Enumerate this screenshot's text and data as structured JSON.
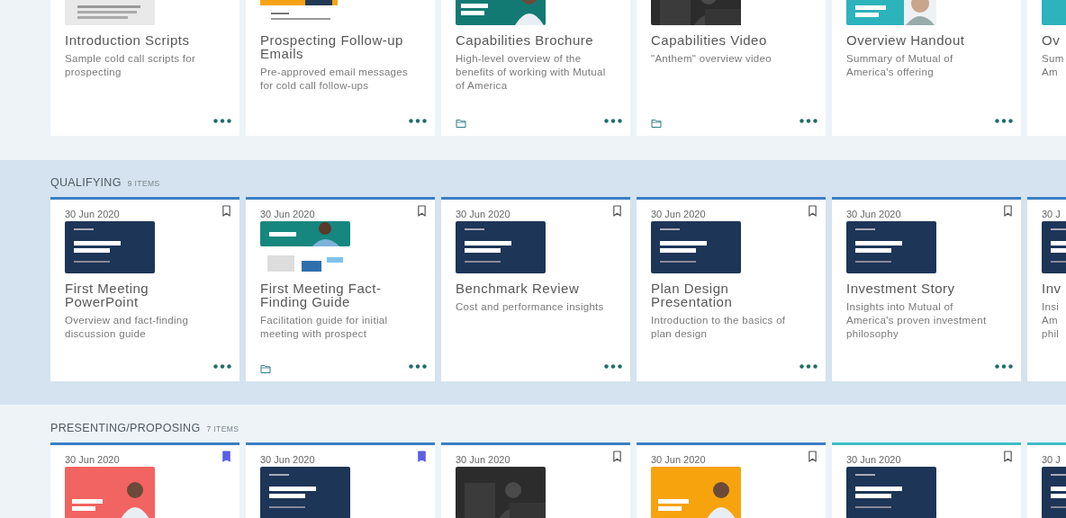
{
  "sections": [
    {
      "highlighted": false,
      "cards": [
        {
          "title": "Introduction Scripts",
          "description": "Sample cold call scripts for prospecting",
          "folder": false
        },
        {
          "title": "Prospecting Follow-up Emails",
          "description": "Pre-approved email messages for cold call follow-ups",
          "folder": false
        },
        {
          "title": "Capabilities Brochure",
          "description": "High-level overview of the benefits of working with Mutual of America",
          "folder": true
        },
        {
          "title": "Capabilities Video",
          "description": "\"Anthem\" overview video",
          "folder": true
        },
        {
          "title": "Overview Handout",
          "description": "Summary of Mutual of America's offering",
          "folder": false
        },
        {
          "title": "Ov",
          "description": "Sum\nAm"
        }
      ]
    },
    {
      "highlighted": true,
      "title": "QUALIFYING",
      "count": "9 ITEMS",
      "cards": [
        {
          "color": "#3b7fc4",
          "date": "30 Jun 2020",
          "bookmarked": false,
          "title": "First Meeting PowerPoint",
          "description": "Overview and fact-finding discussion guide",
          "folder": false
        },
        {
          "color": "#3b7fc4",
          "date": "30 Jun 2020",
          "bookmarked": false,
          "title": "First Meeting Fact-Finding Guide",
          "description": "Facilitation guide for initial meeting with prospect",
          "folder": true
        },
        {
          "color": "#3b7fc4",
          "date": "30 Jun 2020",
          "bookmarked": false,
          "title": "Benchmark Review",
          "description": "Cost and performance insights",
          "folder": false
        },
        {
          "color": "#3b7fc4",
          "date": "30 Jun 2020",
          "bookmarked": false,
          "title": "Plan Design Presentation",
          "description": "Introduction to the basics of plan design",
          "folder": false
        },
        {
          "color": "#3b7fc4",
          "date": "30 Jun 2020",
          "bookmarked": false,
          "title": "Investment Story",
          "description": "Insights into Mutual of America's proven investment philosophy",
          "folder": false
        },
        {
          "color": "#3b7fc4",
          "date": "30 J",
          "title": "Inv",
          "description": "Insi\nAm\nphil"
        }
      ]
    },
    {
      "highlighted": false,
      "title": "PRESENTING/PROPOSING",
      "count": "7 ITEMS",
      "cards": [
        {
          "color": "#3b7fc4",
          "date": "30 Jun 2020",
          "bookmarked": true
        },
        {
          "color": "#3b7fc4",
          "date": "30 Jun 2020",
          "bookmarked": true
        },
        {
          "color": "#3b7fc4",
          "date": "30 Jun 2020",
          "bookmarked": false
        },
        {
          "color": "#3b7fc4",
          "date": "30 Jun 2020",
          "bookmarked": false
        },
        {
          "color": "#3fbdc6",
          "date": "30 Jun 2020",
          "bookmarked": false
        },
        {
          "color": "#3fbdc6",
          "date": "30 J"
        }
      ]
    }
  ]
}
